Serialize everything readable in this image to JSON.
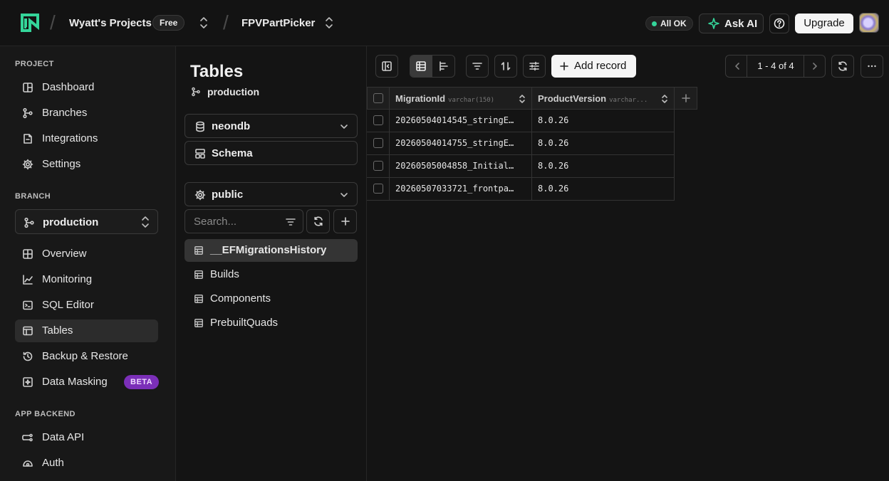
{
  "topbar": {
    "org_name": "Wyatt's Projects",
    "plan_badge": "Free",
    "project_name": "FPVPartPicker",
    "status": "All OK",
    "ask_ai": "Ask AI",
    "upgrade": "Upgrade"
  },
  "sidebar": {
    "project_title": "PROJECT",
    "project_items": [
      {
        "label": "Dashboard",
        "icon": "dashboard-icon"
      },
      {
        "label": "Branches",
        "icon": "branch-icon"
      },
      {
        "label": "Integrations",
        "icon": "integrations-icon"
      },
      {
        "label": "Settings",
        "icon": "gear-icon"
      }
    ],
    "branch_title": "BRANCH",
    "branch_selected": "production",
    "branch_items": [
      {
        "label": "Overview",
        "icon": "overview-icon"
      },
      {
        "label": "Monitoring",
        "icon": "chart-icon"
      },
      {
        "label": "SQL Editor",
        "icon": "terminal-icon"
      },
      {
        "label": "Tables",
        "icon": "table-icon",
        "active": true
      },
      {
        "label": "Backup & Restore",
        "icon": "history-icon"
      },
      {
        "label": "Data Masking",
        "icon": "mask-icon",
        "badge": "BETA"
      }
    ],
    "backend_title": "APP BACKEND",
    "backend_items": [
      {
        "label": "Data API",
        "icon": "api-icon"
      },
      {
        "label": "Auth",
        "icon": "auth-icon"
      }
    ]
  },
  "tables_panel": {
    "title": "Tables",
    "branch": "production",
    "database": "neondb",
    "schema_button": "Schema",
    "schema": "public",
    "search_placeholder": "Search...",
    "tables": [
      {
        "name": "__EFMigrationsHistory",
        "active": true
      },
      {
        "name": "Builds"
      },
      {
        "name": "Components"
      },
      {
        "name": "PrebuiltQuads"
      }
    ]
  },
  "grid": {
    "add_record": "Add record",
    "pagination": "1 - 4 of 4",
    "columns": [
      {
        "name": "MigrationId",
        "type": "varchar(150)"
      },
      {
        "name": "ProductVersion",
        "type": "varchar..."
      }
    ],
    "rows": [
      [
        "20260504014545_stringE…",
        "8.0.26"
      ],
      [
        "20260504014755_stringE…",
        "8.0.26"
      ],
      [
        "20260505004858_Initial…",
        "8.0.26"
      ],
      [
        "20260507033721_frontpa…",
        "8.0.26"
      ]
    ]
  },
  "colors": {
    "accent_green": "#34d59a",
    "beta_purple": "#7b2fb8",
    "background": "#131313"
  }
}
